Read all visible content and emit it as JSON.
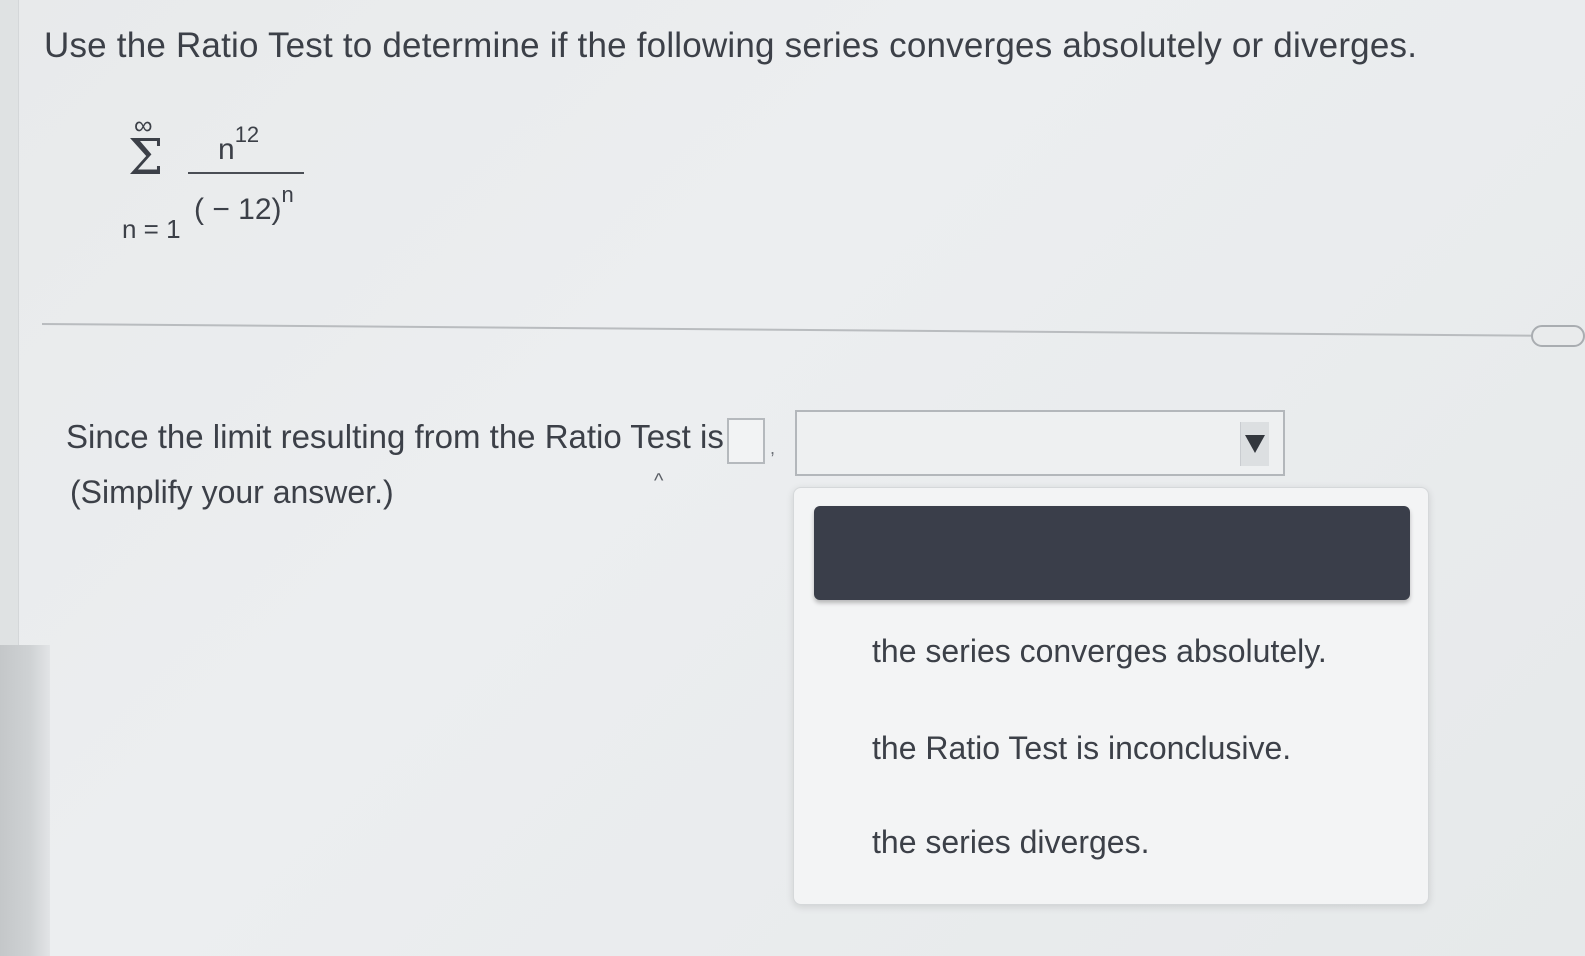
{
  "question": {
    "prompt": "Use the Ratio Test to determine if the following series converges absolutely or diverges."
  },
  "series": {
    "upper_limit": "∞",
    "lower_limit": "n = 1",
    "numerator_base": "n",
    "numerator_exponent": "12",
    "denominator_base": "( − 12)",
    "denominator_exponent": "n"
  },
  "answer": {
    "lead_text": "Since the limit resulting from the Ratio Test is",
    "limit_value": "",
    "separator": ",",
    "hint": "(Simplify your answer.)",
    "selected_conclusion": ""
  },
  "dropdown": {
    "options": [
      "",
      "the series converges absolutely.",
      "the Ratio Test is inconclusive.",
      "the series diverges."
    ]
  }
}
